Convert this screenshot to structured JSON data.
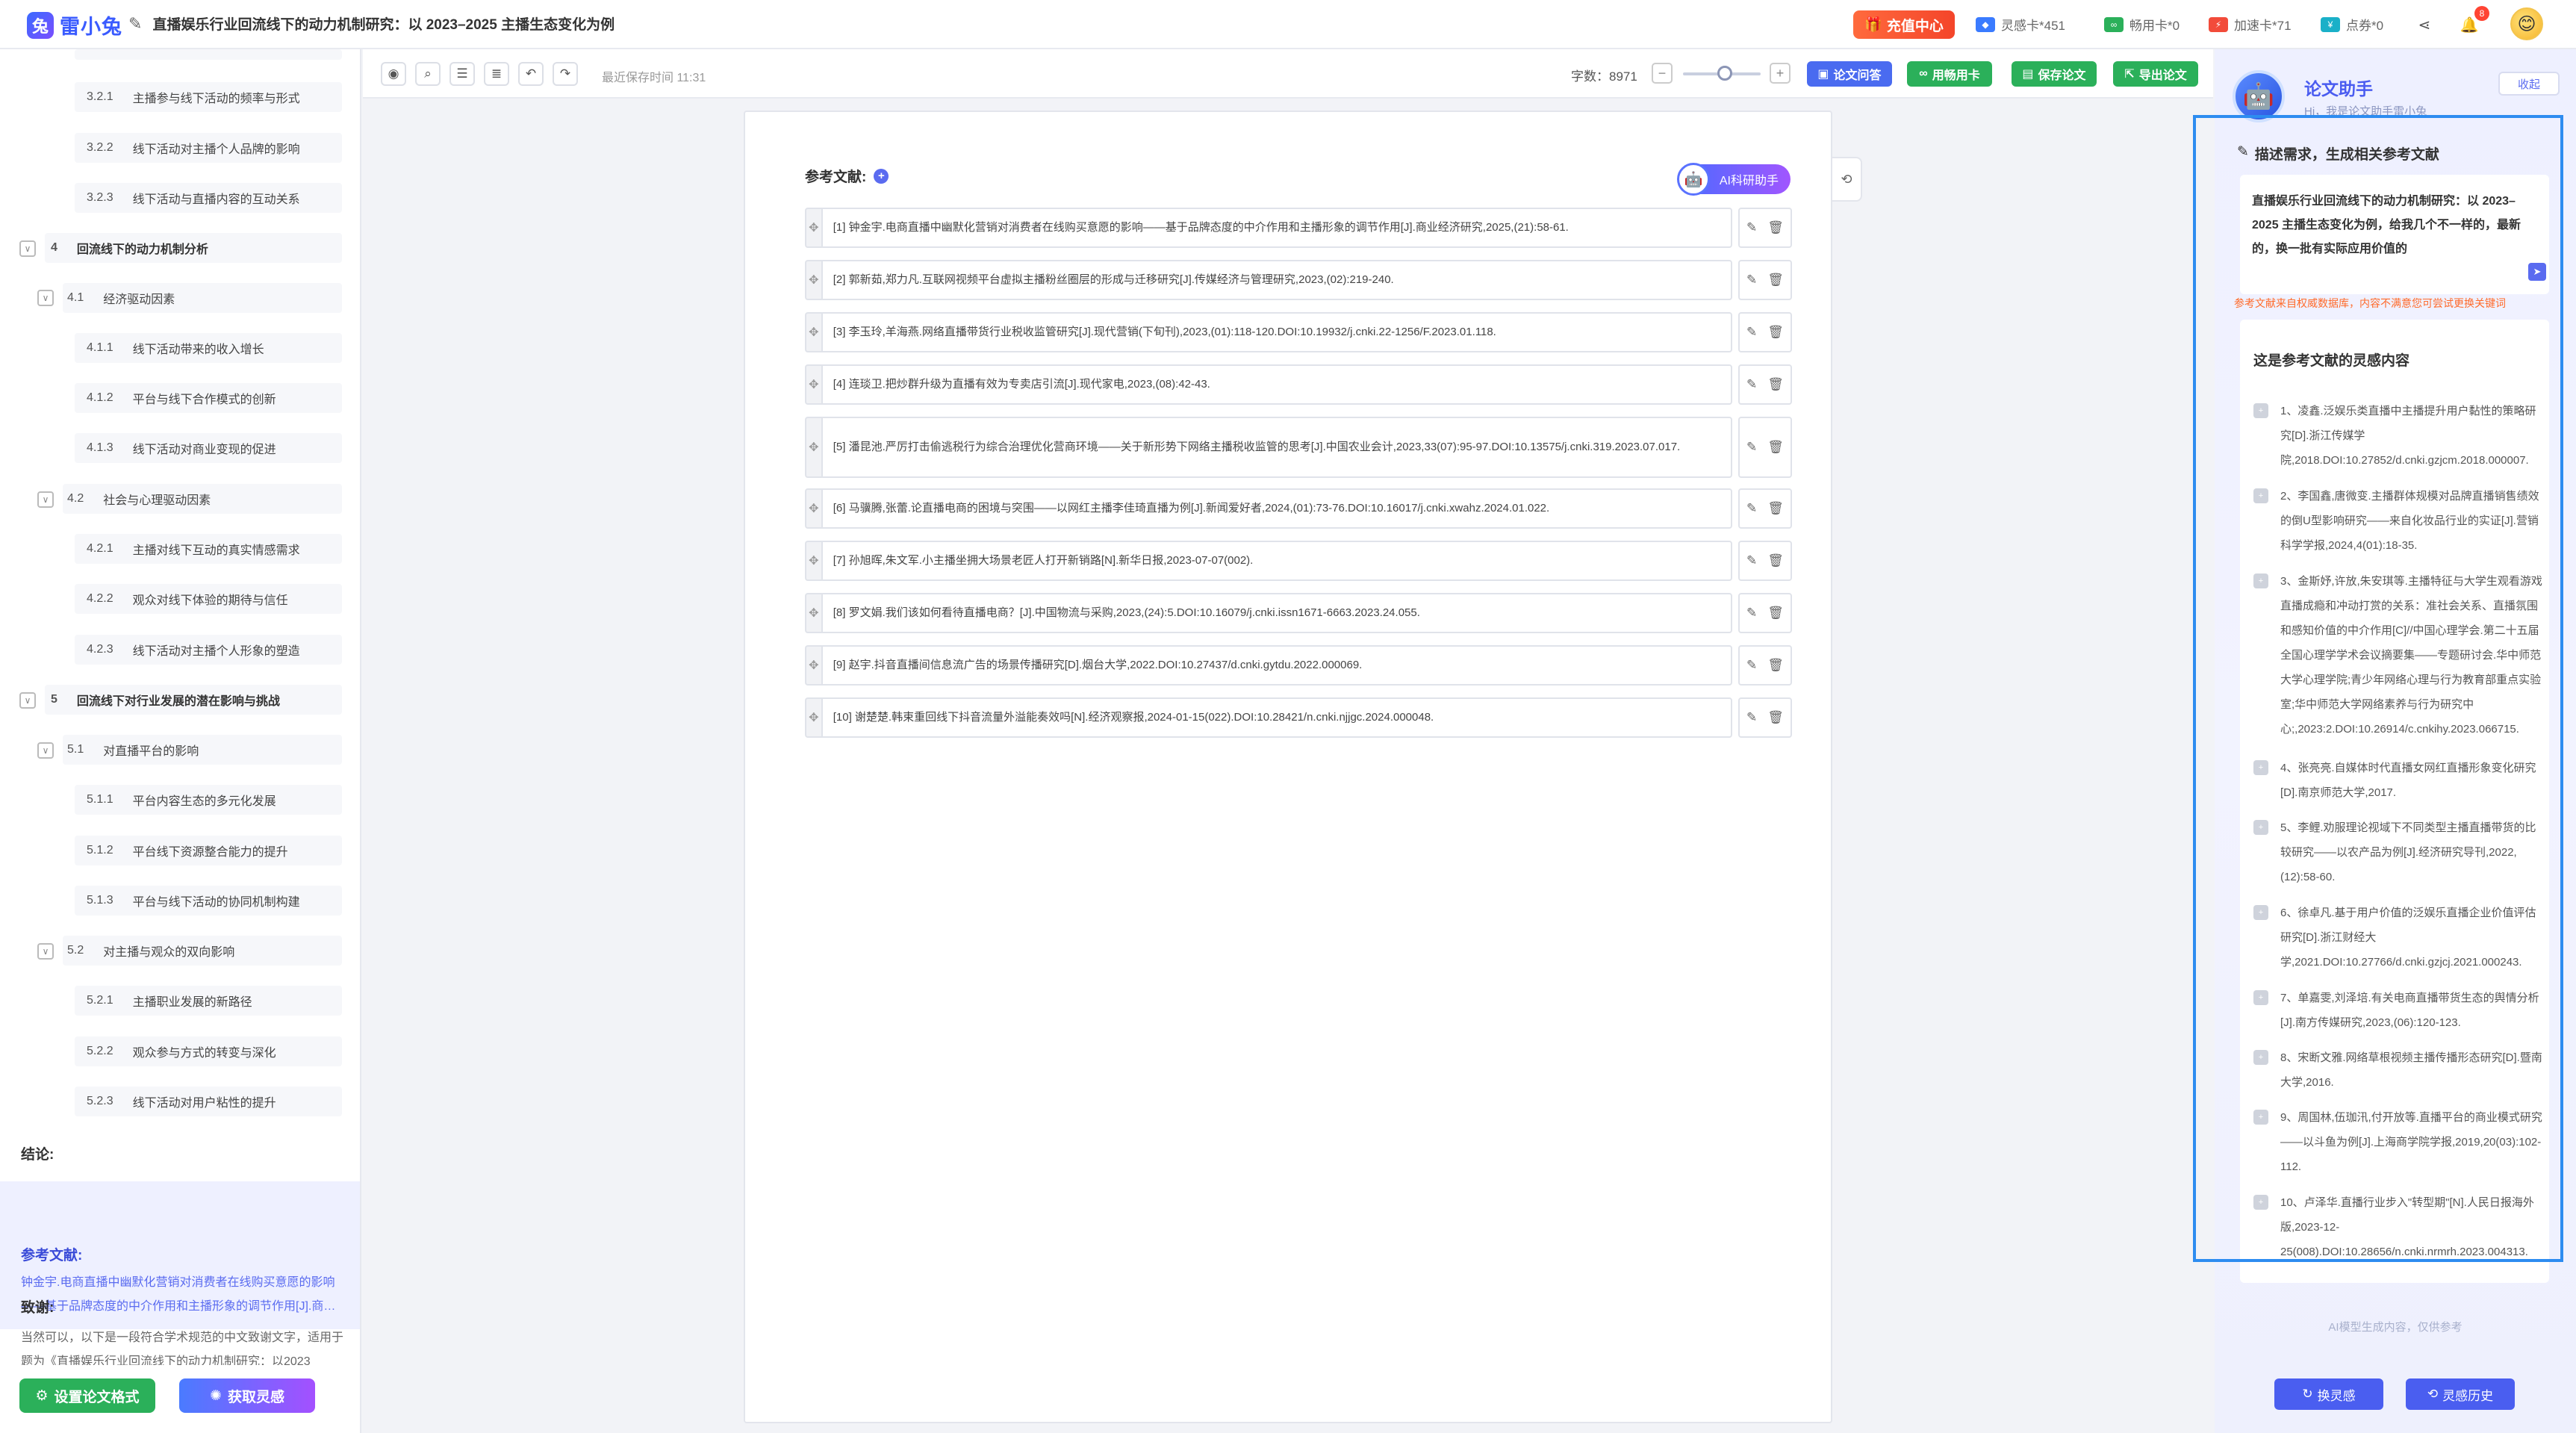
{
  "app": {
    "logo_text": "雷小兔",
    "doc_title": "直播娱乐行业回流线下的动力机制研究：以 2023–2025 主播生态变化为例"
  },
  "topbar": {
    "recharge_label": "充值中心",
    "stats": [
      {
        "label": "灵感卡*451",
        "color": "#3a7bff"
      },
      {
        "label": "畅用卡*0",
        "color": "#2bb05a"
      },
      {
        "label": "加速卡*71",
        "color": "#f24b3a"
      },
      {
        "label": "点券*0",
        "color": "#1ab0c8"
      }
    ],
    "bell_badge": "8"
  },
  "sidebar": {
    "items": [
      {
        "num": "3.2.1",
        "label": "主播参与线下活动的频率与形式",
        "level": 3
      },
      {
        "num": "3.2.2",
        "label": "线下活动对主播个人品牌的影响",
        "level": 3
      },
      {
        "num": "3.2.3",
        "label": "线下活动与直播内容的互动关系",
        "level": 3
      },
      {
        "num": "4",
        "label": "回流线下的动力机制分析",
        "level": 1
      },
      {
        "num": "4.1",
        "label": "经济驱动因素",
        "level": 2
      },
      {
        "num": "4.1.1",
        "label": "线下活动带来的收入增长",
        "level": 3
      },
      {
        "num": "4.1.2",
        "label": "平台与线下合作模式的创新",
        "level": 3
      },
      {
        "num": "4.1.3",
        "label": "线下活动对商业变现的促进",
        "level": 3
      },
      {
        "num": "4.2",
        "label": "社会与心理驱动因素",
        "level": 2
      },
      {
        "num": "4.2.1",
        "label": "主播对线下互动的真实情感需求",
        "level": 3
      },
      {
        "num": "4.2.2",
        "label": "观众对线下体验的期待与信任",
        "level": 3
      },
      {
        "num": "4.2.3",
        "label": "线下活动对主播个人形象的塑造",
        "level": 3
      },
      {
        "num": "5",
        "label": "回流线下对行业发展的潜在影响与挑战",
        "level": 1
      },
      {
        "num": "5.1",
        "label": "对直播平台的影响",
        "level": 2
      },
      {
        "num": "5.1.1",
        "label": "平台内容生态的多元化发展",
        "level": 3
      },
      {
        "num": "5.1.2",
        "label": "平台线下资源整合能力的提升",
        "level": 3
      },
      {
        "num": "5.1.3",
        "label": "平台与线下活动的协同机制构建",
        "level": 3
      },
      {
        "num": "5.2",
        "label": "对主播与观众的双向影响",
        "level": 2
      },
      {
        "num": "5.2.1",
        "label": "主播职业发展的新路径",
        "level": 3
      },
      {
        "num": "5.2.2",
        "label": "观众参与方式的转变与深化",
        "level": 3
      },
      {
        "num": "5.2.3",
        "label": "线下活动对用户粘性的提升",
        "level": 3
      }
    ],
    "conclusion": "结论:",
    "references_heading": "参考文献:",
    "references_preview": "钟金宇.电商直播中幽默化营销对消费者在线购买意愿的影响——基于品牌态度的中介作用和主播形象的调节作用[J].商…",
    "thanks_heading": "致谢:",
    "thanks_text": "当然可以，以下是一段符合学术规范的中文致谢文字，适用于题为《直播娱乐行业回流线下的动力机制研究：以2023",
    "btn_format": "设置论文格式",
    "btn_inspire": "获取灵感"
  },
  "toolbar": {
    "save_time": "最近保存时间 11:31",
    "wordcount": "字数：8971",
    "buttons": [
      {
        "label": "论文问答",
        "color": "#4a6bf0"
      },
      {
        "label": "用畅用卡",
        "color": "#2bb05a"
      },
      {
        "label": "保存论文",
        "color": "#2bb05a"
      },
      {
        "label": "导出论文",
        "color": "#2bb05a"
      }
    ]
  },
  "paper": {
    "refs_title": "参考文献:",
    "ai_helper": "AI科研助手",
    "references": [
      "[1] 钟金宇.电商直播中幽默化营销对消费者在线购买意愿的影响——基于品牌态度的中介作用和主播形象的调节作用[J].商业经济研究,2025,(21):58-61.",
      "[2] 郭新茹,郑力凡.互联网视频平台虚拟主播粉丝圈层的形成与迁移研究[J].传媒经济与管理研究,2023,(02):219-240.",
      "[3] 李玉玲,羊海燕.网络直播带货行业税收监管研究[J].现代营销(下旬刊),2023,(01):118-120.DOI:10.19932/j.cnki.22-1256/F.2023.01.118.",
      "[4] 连琰卫.把炒群升级为直播有效为专卖店引流[J].现代家电,2023,(08):42-43.",
      "[5] 潘昆池.严厉打击偷逃税行为综合治理优化营商环境——关于新形势下网络主播税收监管的思考[J].中国农业会计,2023,33(07):95-97.DOI:10.13575/j.cnki.319.2023.07.017.",
      "[6] 马骥腾,张蕾.论直播电商的困境与突围——以网红主播李佳琦直播为例[J].新闻爱好者,2024,(01):73-76.DOI:10.16017/j.cnki.xwahz.2024.01.022.",
      "[7] 孙旭晖,朱文军.小主播坐拥大场景老匠人打开新销路[N].新华日报,2023-07-07(002).",
      "[8] 罗文娟.我们该如何看待直播电商？[J].中国物流与采购,2023,(24):5.DOI:10.16079/j.cnki.issn1671-6663.2023.24.055.",
      "[9] 赵宇.抖音直播间信息流广告的场景传播研究[D].烟台大学,2022.DOI:10.27437/d.cnki.gytdu.2022.000069.",
      "[10] 谢楚楚.韩束重回线下抖音流量外溢能奏效吗[N].经济观察报,2024-01-15(022).DOI:10.28421/n.cnki.njjgc.2024.000048."
    ]
  },
  "assistant": {
    "title": "论文助手",
    "subtitle": "Hi，我是论文助手雷小兔",
    "collapse": "收起",
    "desc_label": "描述需求，生成相关参考文献",
    "desc_text": "直播娱乐行业回流线下的动力机制研究：以 2023–2025 主播生态变化为例，给我几个不一样的，最新的，换一批有实际应用价值的",
    "note": "参考文献来自权威数据库，内容不满意您可尝试更换关键词",
    "insp_title": "这是参考文献的灵感内容",
    "items": [
      "1、凌鑫.泛娱乐类直播中主播提升用户黏性的策略研究[D].浙江传媒学院,2018.DOI:10.27852/d.cnki.gzjcm.2018.000007.",
      "2、李国鑫,唐微变.主播群体规模对品牌直播销售绩效的倒U型影响研究——来自化妆品行业的实证[J].营销科学学报,2024,4(01):18-35.",
      "3、金斯妤,许放,朱安琪等.主播特征与大学生观看游戏直播成瘾和冲动打赏的关系：准社会关系、直播氛围和感知价值的中介作用[C]//中国心理学会.第二十五届全国心理学学术会议摘要集——专题研讨会.华中师范大学心理学院;青少年网络心理与行为教育部重点实验室;华中师范大学网络素养与行为研究中心;,2023:2.DOI:10.26914/c.cnkihy.2023.066715.",
      "4、张亮亮.自媒体时代直播女网红直播形象变化研究[D].南京师范大学,2017.",
      "5、李鲤.劝服理论视域下不同类型主播直播带货的比较研究——以农产品为例[J].经济研究导刊,2022,(12):58-60.",
      "6、徐卓凡.基于用户价值的泛娱乐直播企业价值评估研究[D].浙江财经大学,2021.DOI:10.27766/d.cnki.gzjcj.2021.000243.",
      "7、单嘉雯,刘泽培.有关电商直播带货生态的舆情分析[J].南方传媒研究,2023,(06):120-123.",
      "8、宋断文雅.网络草根视频主播传播形态研究[D].暨南大学,2016.",
      "9、周国林,伍珈汛,付开放等.直播平台的商业模式研究——以斗鱼为例[J].上海商学院学报,2019,20(03):102-112.",
      "10、卢泽华.直播行业步入\"转型期\"[N].人民日报海外版,2023-12-25(008).DOI:10.28656/n.cnki.nrmrh.2023.004313."
    ],
    "ai_generated": "AI模型生成内容，仅供参考",
    "btn_change": "换灵感",
    "btn_history": "灵感历史"
  }
}
